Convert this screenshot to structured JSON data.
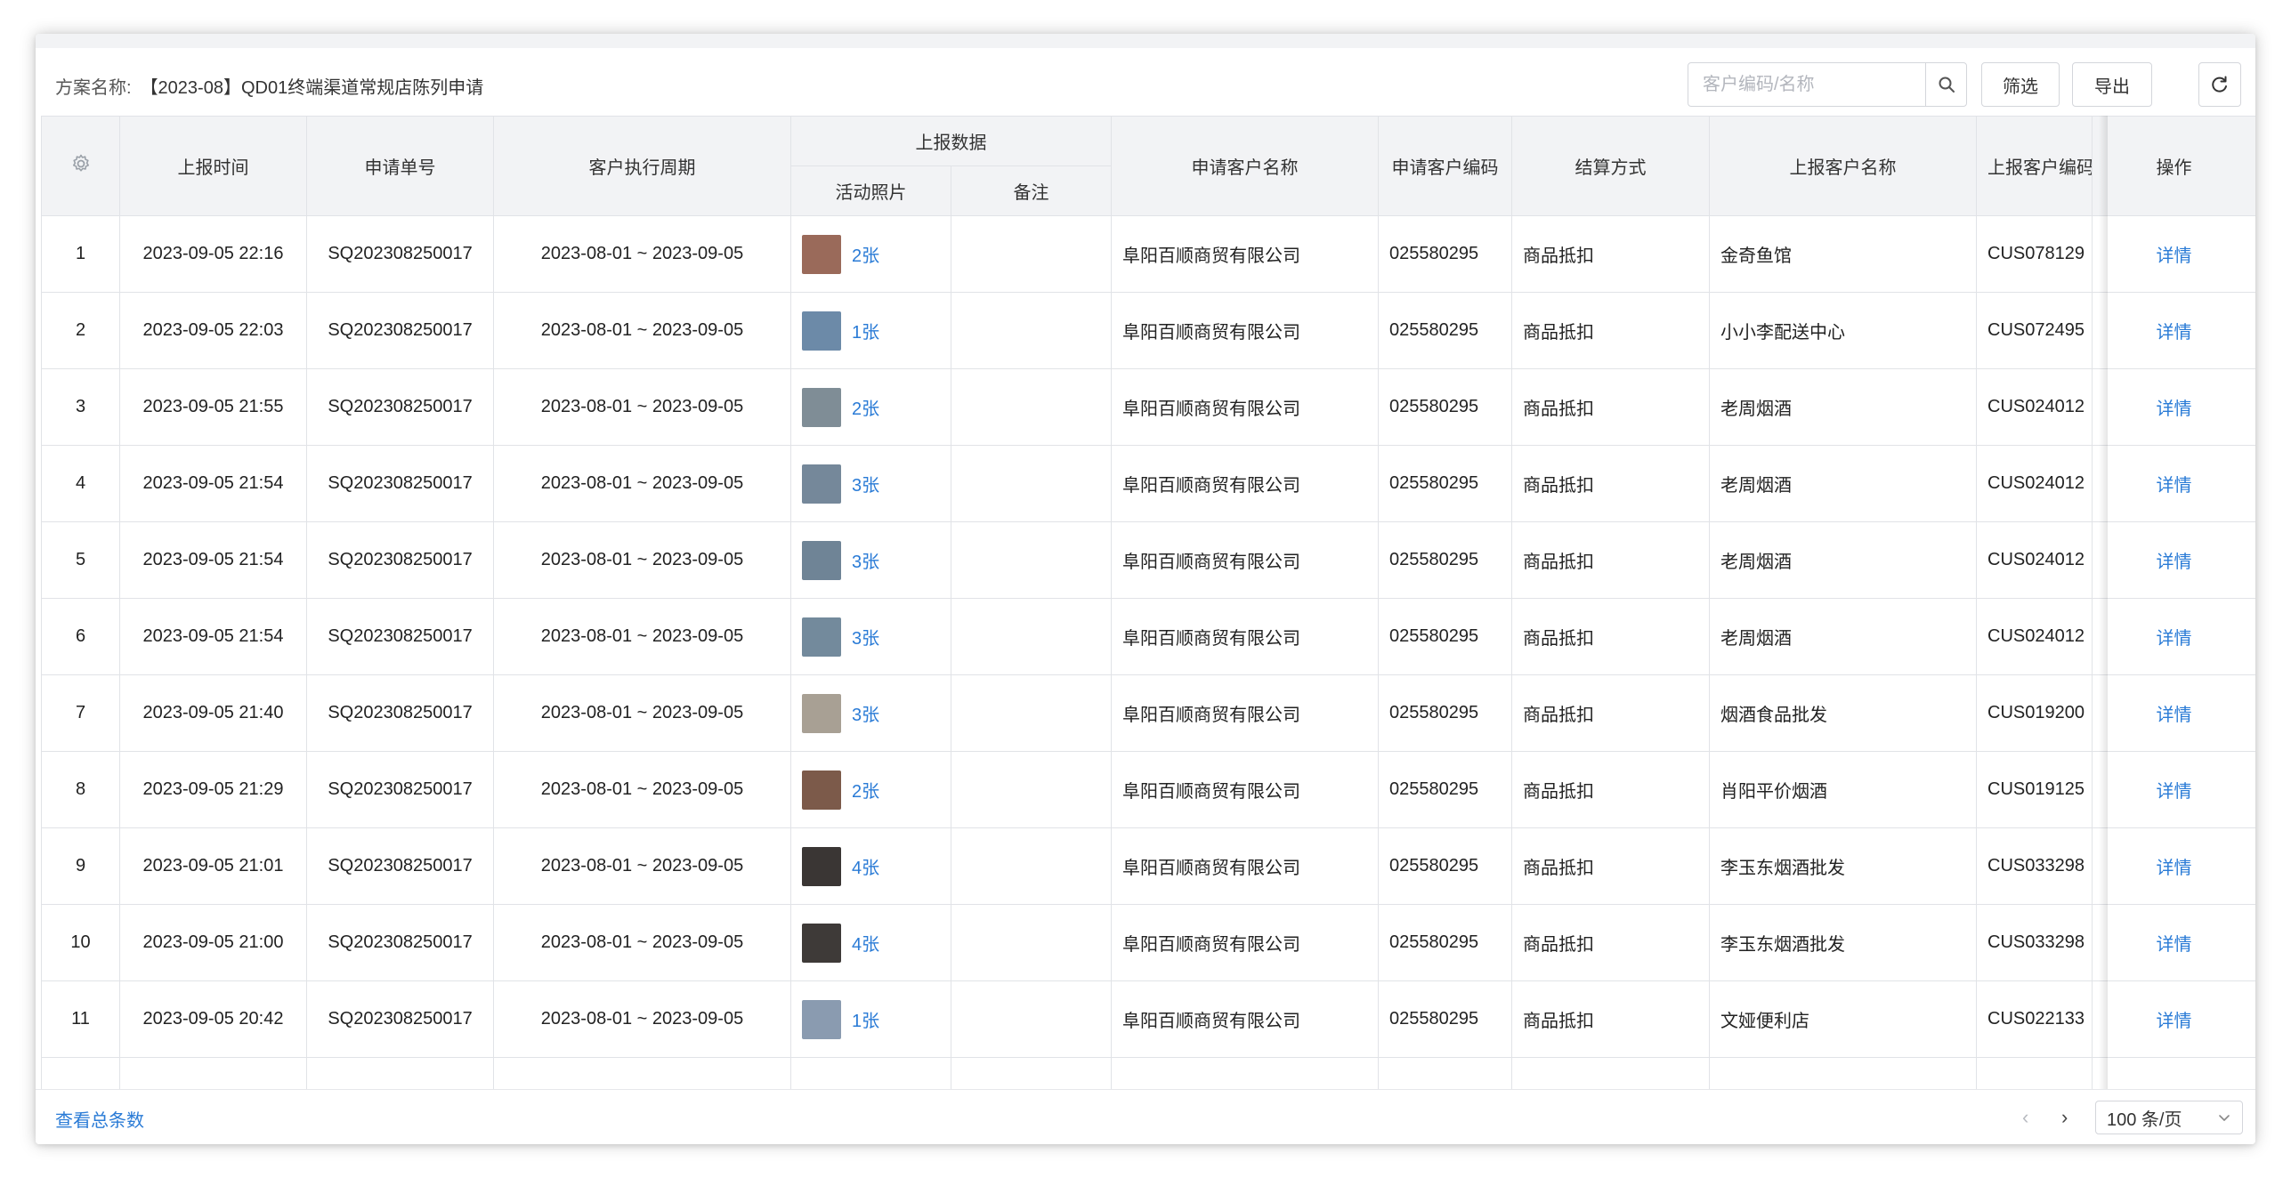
{
  "toolbar": {
    "plan_key": "方案名称:",
    "plan_name": "【2023-08】QD01终端渠道常规店陈列申请",
    "search_placeholder": "客户编码/名称",
    "filter_label": "筛选",
    "export_label": "导出"
  },
  "table": {
    "headers": {
      "report_time": "上报时间",
      "order_no": "申请单号",
      "period": "客户执行周期",
      "report_data": "上报数据",
      "photos": "活动照片",
      "remarks": "备注",
      "apply_name": "申请客户名称",
      "apply_code": "申请客户编码",
      "settlement": "结算方式",
      "report_name": "上报客户名称",
      "report_code": "上报客户编码",
      "action": "操作"
    },
    "rows": [
      {
        "idx": "1",
        "time": "2023-09-05 22:16",
        "order": "SQ202308250017",
        "period": "2023-08-01 ~ 2023-09-05",
        "photos": "2张",
        "remark": "",
        "apply_name": "阜阳百顺商贸有限公司",
        "apply_code": "025580295",
        "settle": "商品抵扣",
        "report_name": "金奇鱼馆",
        "report_code": "CUS078129",
        "action": "详情",
        "thumb": "#9a6a5a"
      },
      {
        "idx": "2",
        "time": "2023-09-05 22:03",
        "order": "SQ202308250017",
        "period": "2023-08-01 ~ 2023-09-05",
        "photos": "1张",
        "remark": "",
        "apply_name": "阜阳百顺商贸有限公司",
        "apply_code": "025580295",
        "settle": "商品抵扣",
        "report_name": "小小李配送中心",
        "report_code": "CUS072495",
        "action": "详情",
        "thumb": "#6c8aa8"
      },
      {
        "idx": "3",
        "time": "2023-09-05 21:55",
        "order": "SQ202308250017",
        "period": "2023-08-01 ~ 2023-09-05",
        "photos": "2张",
        "remark": "",
        "apply_name": "阜阳百顺商贸有限公司",
        "apply_code": "025580295",
        "settle": "商品抵扣",
        "report_name": "老周烟酒",
        "report_code": "CUS024012",
        "action": "详情",
        "thumb": "#7f8d96"
      },
      {
        "idx": "4",
        "time": "2023-09-05 21:54",
        "order": "SQ202308250017",
        "period": "2023-08-01 ~ 2023-09-05",
        "photos": "3张",
        "remark": "",
        "apply_name": "阜阳百顺商贸有限公司",
        "apply_code": "025580295",
        "settle": "商品抵扣",
        "report_name": "老周烟酒",
        "report_code": "CUS024012",
        "action": "详情",
        "thumb": "#75889a"
      },
      {
        "idx": "5",
        "time": "2023-09-05 21:54",
        "order": "SQ202308250017",
        "period": "2023-08-01 ~ 2023-09-05",
        "photos": "3张",
        "remark": "",
        "apply_name": "阜阳百顺商贸有限公司",
        "apply_code": "025580295",
        "settle": "商品抵扣",
        "report_name": "老周烟酒",
        "report_code": "CUS024012",
        "action": "详情",
        "thumb": "#6f8496"
      },
      {
        "idx": "6",
        "time": "2023-09-05 21:54",
        "order": "SQ202308250017",
        "period": "2023-08-01 ~ 2023-09-05",
        "photos": "3张",
        "remark": "",
        "apply_name": "阜阳百顺商贸有限公司",
        "apply_code": "025580295",
        "settle": "商品抵扣",
        "report_name": "老周烟酒",
        "report_code": "CUS024012",
        "action": "详情",
        "thumb": "#738a9c"
      },
      {
        "idx": "7",
        "time": "2023-09-05 21:40",
        "order": "SQ202308250017",
        "period": "2023-08-01 ~ 2023-09-05",
        "photos": "3张",
        "remark": "",
        "apply_name": "阜阳百顺商贸有限公司",
        "apply_code": "025580295",
        "settle": "商品抵扣",
        "report_name": "烟酒食品批发",
        "report_code": "CUS019200",
        "action": "详情",
        "thumb": "#a8a094"
      },
      {
        "idx": "8",
        "time": "2023-09-05 21:29",
        "order": "SQ202308250017",
        "period": "2023-08-01 ~ 2023-09-05",
        "photos": "2张",
        "remark": "",
        "apply_name": "阜阳百顺商贸有限公司",
        "apply_code": "025580295",
        "settle": "商品抵扣",
        "report_name": "肖阳平价烟酒",
        "report_code": "CUS019125",
        "action": "详情",
        "thumb": "#7c5a4a"
      },
      {
        "idx": "9",
        "time": "2023-09-05 21:01",
        "order": "SQ202308250017",
        "period": "2023-08-01 ~ 2023-09-05",
        "photos": "4张",
        "remark": "",
        "apply_name": "阜阳百顺商贸有限公司",
        "apply_code": "025580295",
        "settle": "商品抵扣",
        "report_name": "李玉东烟酒批发",
        "report_code": "CUS033298",
        "action": "详情",
        "thumb": "#3a3634"
      },
      {
        "idx": "10",
        "time": "2023-09-05 21:00",
        "order": "SQ202308250017",
        "period": "2023-08-01 ~ 2023-09-05",
        "photos": "4张",
        "remark": "",
        "apply_name": "阜阳百顺商贸有限公司",
        "apply_code": "025580295",
        "settle": "商品抵扣",
        "report_name": "李玉东烟酒批发",
        "report_code": "CUS033298",
        "action": "详情",
        "thumb": "#3e3a38"
      },
      {
        "idx": "11",
        "time": "2023-09-05 20:42",
        "order": "SQ202308250017",
        "period": "2023-08-01 ~ 2023-09-05",
        "photos": "1张",
        "remark": "",
        "apply_name": "阜阳百顺商贸有限公司",
        "apply_code": "025580295",
        "settle": "商品抵扣",
        "report_name": "文娅便利店",
        "report_code": "CUS022133",
        "action": "详情",
        "thumb": "#8a9bb0"
      }
    ]
  },
  "footer": {
    "total_link": "查看总条数",
    "page_size": "100 条/页"
  },
  "colors": {
    "link": "#2a7bd6",
    "header_bg": "#f2f3f5",
    "border": "#e1e3e7"
  }
}
